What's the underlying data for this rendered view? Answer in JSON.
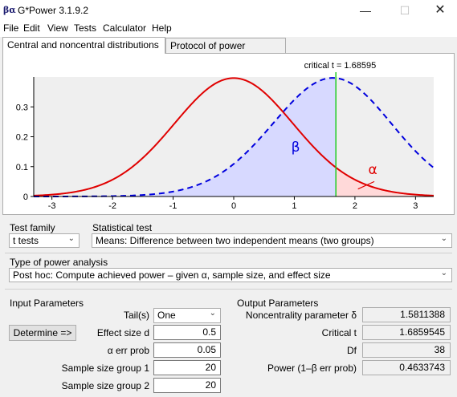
{
  "window": {
    "title": "G*Power 3.1.9.2",
    "icon": "G*Power app icon",
    "icon_glyph": "βα"
  },
  "menu": [
    "File",
    "Edit",
    "View",
    "Tests",
    "Calculator",
    "Help"
  ],
  "tabs": [
    "Central and noncentral distributions",
    "Protocol of power analyses"
  ],
  "chart_data": {
    "type": "line",
    "annotation": "critical t = 1.68595",
    "critical_t": 1.68595,
    "df": 38,
    "noncentrality": 1.5811388,
    "xlim": [
      -3.3,
      3.3
    ],
    "ylim": [
      0,
      0.4
    ],
    "x_ticks": [
      "-3",
      "-2",
      "-1",
      "0",
      "1",
      "2",
      "3"
    ],
    "y_ticks": [
      "0",
      "0.1",
      "0.2",
      "0.3"
    ],
    "series": [
      {
        "style": "solid",
        "color": "#e00000"
      },
      {
        "style": "dashed",
        "color": "#0000dd"
      }
    ],
    "beta_label": "β",
    "alpha_label": "α",
    "colors": {
      "beta_fill": "#d7d9ff",
      "alpha_fill": "#ffd9d9",
      "critical_line": "#22cc22",
      "background": "#efefef"
    }
  },
  "test_family": {
    "label": "Test family",
    "value": "t tests"
  },
  "statistical_test": {
    "label": "Statistical test",
    "value": "Means: Difference between two independent means (two groups)"
  },
  "power_analysis": {
    "label": "Type of power analysis",
    "value": "Post hoc: Compute achieved power – given α, sample size, and effect size"
  },
  "input": {
    "title": "Input Parameters",
    "tails_label": "Tail(s)",
    "tails_value": "One",
    "determine_button": "Determine =>",
    "effect_label": "Effect size d",
    "effect_value": "0.5",
    "alpha_label": "α err prob",
    "alpha_value": "0.05",
    "n1_label": "Sample size group 1",
    "n1_value": "20",
    "n2_label": "Sample size group 2",
    "n2_value": "20"
  },
  "output": {
    "title": "Output Parameters",
    "ncp_label": "Noncentrality parameter δ",
    "ncp_value": "1.5811388",
    "crit_label": "Critical t",
    "crit_value": "1.6859545",
    "df_label": "Df",
    "df_value": "38",
    "power_label": "Power (1–β err prob)",
    "power_value": "0.4633743"
  }
}
